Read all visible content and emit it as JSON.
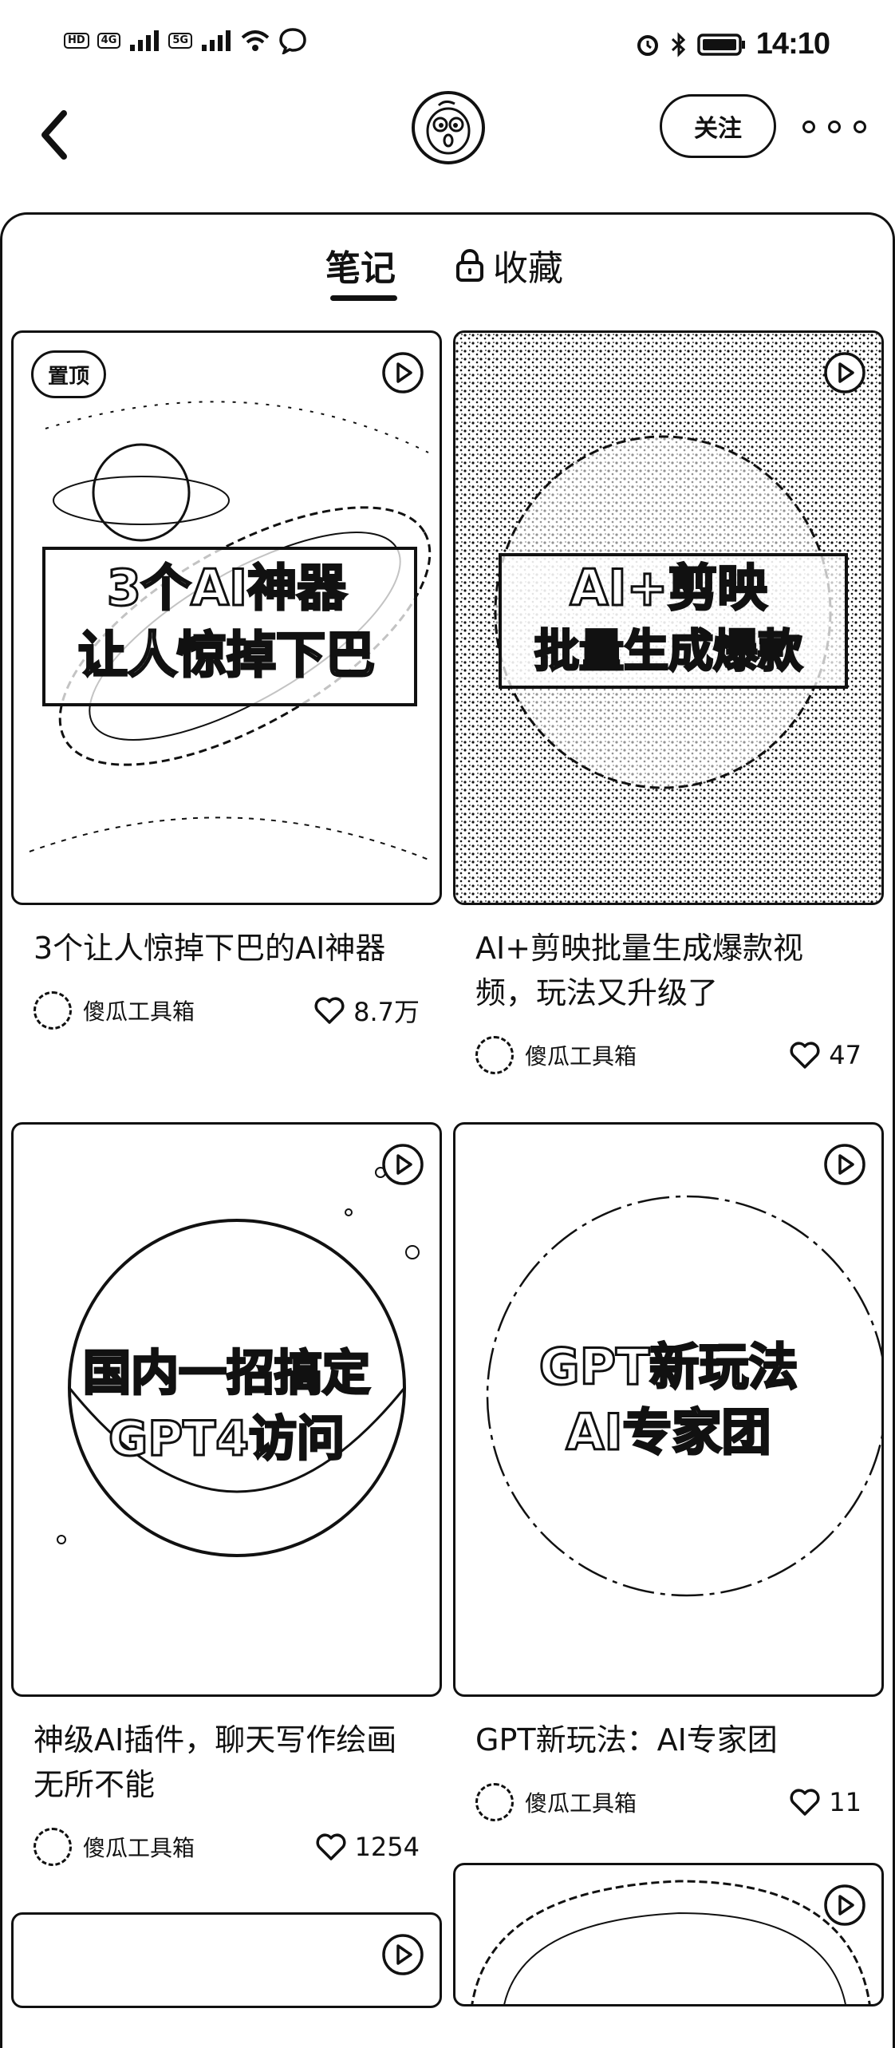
{
  "status_bar": {
    "chips": [
      "HD",
      "4G",
      "5G"
    ],
    "time": "14:10"
  },
  "header": {
    "follow_label": "关注"
  },
  "tabs": {
    "notes": "笔记",
    "favorites": "收藏"
  },
  "cards": [
    {
      "pinned_label": "置顶",
      "cover_lines": [
        "3个AI神器",
        "让人惊掉下巴"
      ],
      "title": "3个让人惊掉下巴的AI神器",
      "author": "傻瓜工具箱",
      "likes": "8.7万"
    },
    {
      "cover_lines": [
        "AI+剪映",
        "批量生成爆款"
      ],
      "title": "AI+剪映批量生成爆款视频，玩法又升级了",
      "author": "傻瓜工具箱",
      "likes": "47"
    },
    {
      "cover_lines": [
        "国内一招搞定",
        "GPT4访问"
      ],
      "title": "神级AI插件，聊天写作绘画无所不能",
      "author": "傻瓜工具箱",
      "likes": "1254"
    },
    {
      "cover_lines": [
        "GPT新玩法",
        "AI专家团"
      ],
      "title": "GPT新玩法：AI专家团",
      "author": "傻瓜工具箱",
      "likes": "11"
    }
  ]
}
